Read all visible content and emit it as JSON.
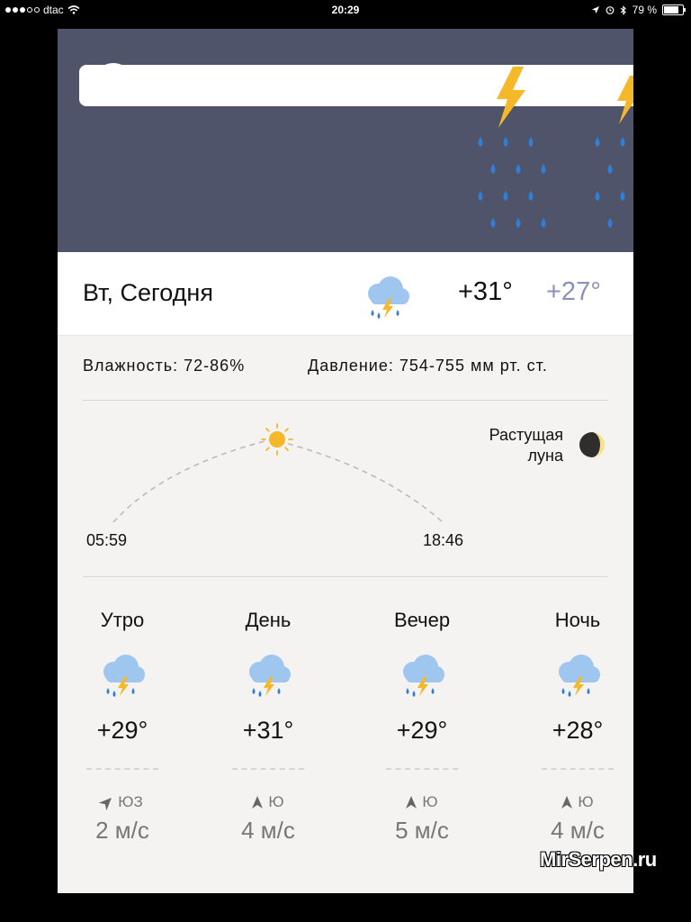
{
  "status_bar": {
    "carrier": "dtac",
    "time": "20:29",
    "battery": "79 %",
    "battery_level": 0.79,
    "icons": [
      "signal-dots-icon",
      "wifi-icon",
      "location-icon",
      "alarm-icon",
      "bluetooth-icon",
      "battery-icon"
    ]
  },
  "hero": {
    "icons": [
      "cloud-icon",
      "lightning-icon",
      "raindrop-icon"
    ],
    "background": "#4f546a"
  },
  "today": {
    "label": "Вт, Сегодня",
    "icon": "thunderstorm-icon",
    "temp_high": "+31°",
    "temp_low": "+27°"
  },
  "details": {
    "humidity_label": "Влажность:",
    "humidity_value": "72-86%",
    "pressure_label": "Давление:",
    "pressure_value": "754-755",
    "pressure_unit": "мм рт. ст."
  },
  "sun": {
    "sunrise": "05:59",
    "sunset": "18:46",
    "icon": "sun-icon"
  },
  "moon": {
    "phase_line1": "Растущая",
    "phase_line2": "луна",
    "icon": "waxing-moon-icon"
  },
  "periods": [
    {
      "name": "Утро",
      "temp": "+29°",
      "wind_dir": "ЮЗ",
      "wind_speed": "2 м/с",
      "icon": "thunderstorm-icon",
      "wind_icon": "wind-arrow-icon"
    },
    {
      "name": "День",
      "temp": "+31°",
      "wind_dir": "Ю",
      "wind_speed": "4 м/с",
      "icon": "thunderstorm-icon",
      "wind_icon": "wind-arrow-icon"
    },
    {
      "name": "Вечер",
      "temp": "+29°",
      "wind_dir": "Ю",
      "wind_speed": "5 м/с",
      "icon": "thunderstorm-icon",
      "wind_icon": "wind-arrow-icon"
    },
    {
      "name": "Ночь",
      "temp": "+28°",
      "wind_dir": "Ю",
      "wind_speed": "4 м/с",
      "icon": "thunderstorm-icon",
      "wind_icon": "wind-arrow-icon"
    }
  ],
  "watermark": "MirSerpen.ru",
  "colors": {
    "accent_low_temp": "#8a8fbf",
    "lightning": "#f5b829",
    "rain": "#2f7fd6",
    "cloud": "#9ec6ef",
    "sun": "#f5b829",
    "moon": "#f7e28a"
  }
}
